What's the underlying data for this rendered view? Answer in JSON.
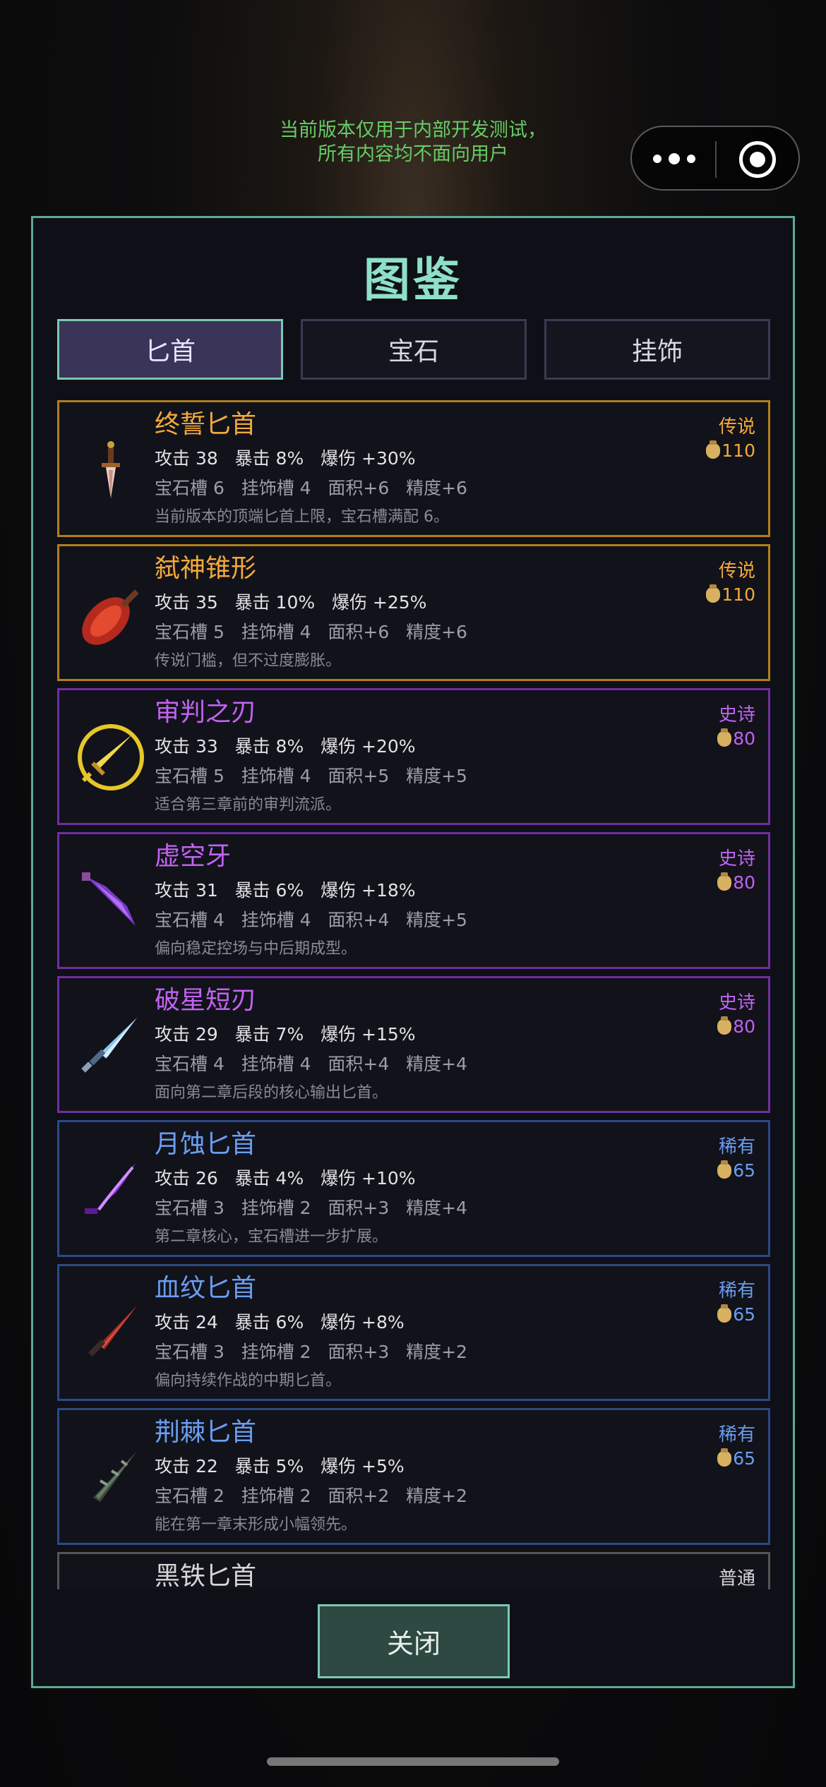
{
  "banner": {
    "line1": "当前版本仅用于内部开发测试，",
    "line2": "所有内容均不面向用户"
  },
  "panel": {
    "title": "图鉴",
    "tabs": [
      "匕首",
      "宝石",
      "挂饰"
    ],
    "active_tab": "匕首",
    "close_label": "关闭"
  },
  "items": [
    {
      "name": "终誓匕首",
      "rarity": "传说",
      "price": "110",
      "atk": "攻击 38",
      "crit": "暴击 8%",
      "critdmg": "爆伤 +30%",
      "gem": "宝石槽 6",
      "charm": "挂饰槽 4",
      "area": "面积+6",
      "acc": "精度+6",
      "desc": "当前版本的顶端匕首上限，宝石槽满配 6。",
      "tier": "legendary"
    },
    {
      "name": "弑神锥形",
      "rarity": "传说",
      "price": "110",
      "atk": "攻击 35",
      "crit": "暴击 10%",
      "critdmg": "爆伤 +25%",
      "gem": "宝石槽 5",
      "charm": "挂饰槽 4",
      "area": "面积+6",
      "acc": "精度+6",
      "desc": "传说门槛，但不过度膨胀。",
      "tier": "legendary"
    },
    {
      "name": "审判之刃",
      "rarity": "史诗",
      "price": "80",
      "atk": "攻击 33",
      "crit": "暴击 8%",
      "critdmg": "爆伤 +20%",
      "gem": "宝石槽 5",
      "charm": "挂饰槽 4",
      "area": "面积+5",
      "acc": "精度+5",
      "desc": "适合第三章前的审判流派。",
      "tier": "epic"
    },
    {
      "name": "虚空牙",
      "rarity": "史诗",
      "price": "80",
      "atk": "攻击 31",
      "crit": "暴击 6%",
      "critdmg": "爆伤 +18%",
      "gem": "宝石槽 4",
      "charm": "挂饰槽 4",
      "area": "面积+4",
      "acc": "精度+5",
      "desc": "偏向稳定控场与中后期成型。",
      "tier": "epic"
    },
    {
      "name": "破星短刃",
      "rarity": "史诗",
      "price": "80",
      "atk": "攻击 29",
      "crit": "暴击 7%",
      "critdmg": "爆伤 +15%",
      "gem": "宝石槽 4",
      "charm": "挂饰槽 4",
      "area": "面积+4",
      "acc": "精度+4",
      "desc": "面向第二章后段的核心输出匕首。",
      "tier": "epic"
    },
    {
      "name": "月蚀匕首",
      "rarity": "稀有",
      "price": "65",
      "atk": "攻击 26",
      "crit": "暴击 4%",
      "critdmg": "爆伤 +10%",
      "gem": "宝石槽 3",
      "charm": "挂饰槽 2",
      "area": "面积+3",
      "acc": "精度+4",
      "desc": "第二章核心，宝石槽进一步扩展。",
      "tier": "rare"
    },
    {
      "name": "血纹匕首",
      "rarity": "稀有",
      "price": "65",
      "atk": "攻击 24",
      "crit": "暴击 6%",
      "critdmg": "爆伤 +8%",
      "gem": "宝石槽 3",
      "charm": "挂饰槽 2",
      "area": "面积+3",
      "acc": "精度+2",
      "desc": "偏向持续作战的中期匕首。",
      "tier": "rare"
    },
    {
      "name": "荆棘匕首",
      "rarity": "稀有",
      "price": "65",
      "atk": "攻击 22",
      "crit": "暴击 5%",
      "critdmg": "爆伤 +5%",
      "gem": "宝石槽 2",
      "charm": "挂饰槽 2",
      "area": "面积+2",
      "acc": "精度+2",
      "desc": "能在第一章末形成小幅领先。",
      "tier": "rare"
    },
    {
      "name": "黑铁匕首",
      "rarity": "普通",
      "price": "",
      "atk": "",
      "crit": "",
      "critdmg": "",
      "gem": "",
      "charm": "",
      "area": "",
      "acc": "",
      "desc": "",
      "tier": "common"
    }
  ],
  "colors": {
    "legendary": "#f2a93b",
    "epic": "#c163f1",
    "rare": "#6a9ef0",
    "common": "#d6d6d6",
    "accent": "#7ac9b2",
    "banner": "#66cc66"
  },
  "icons": [
    "more-icon",
    "target-icon",
    "coin-bag-icon",
    "dagger-icon"
  ]
}
